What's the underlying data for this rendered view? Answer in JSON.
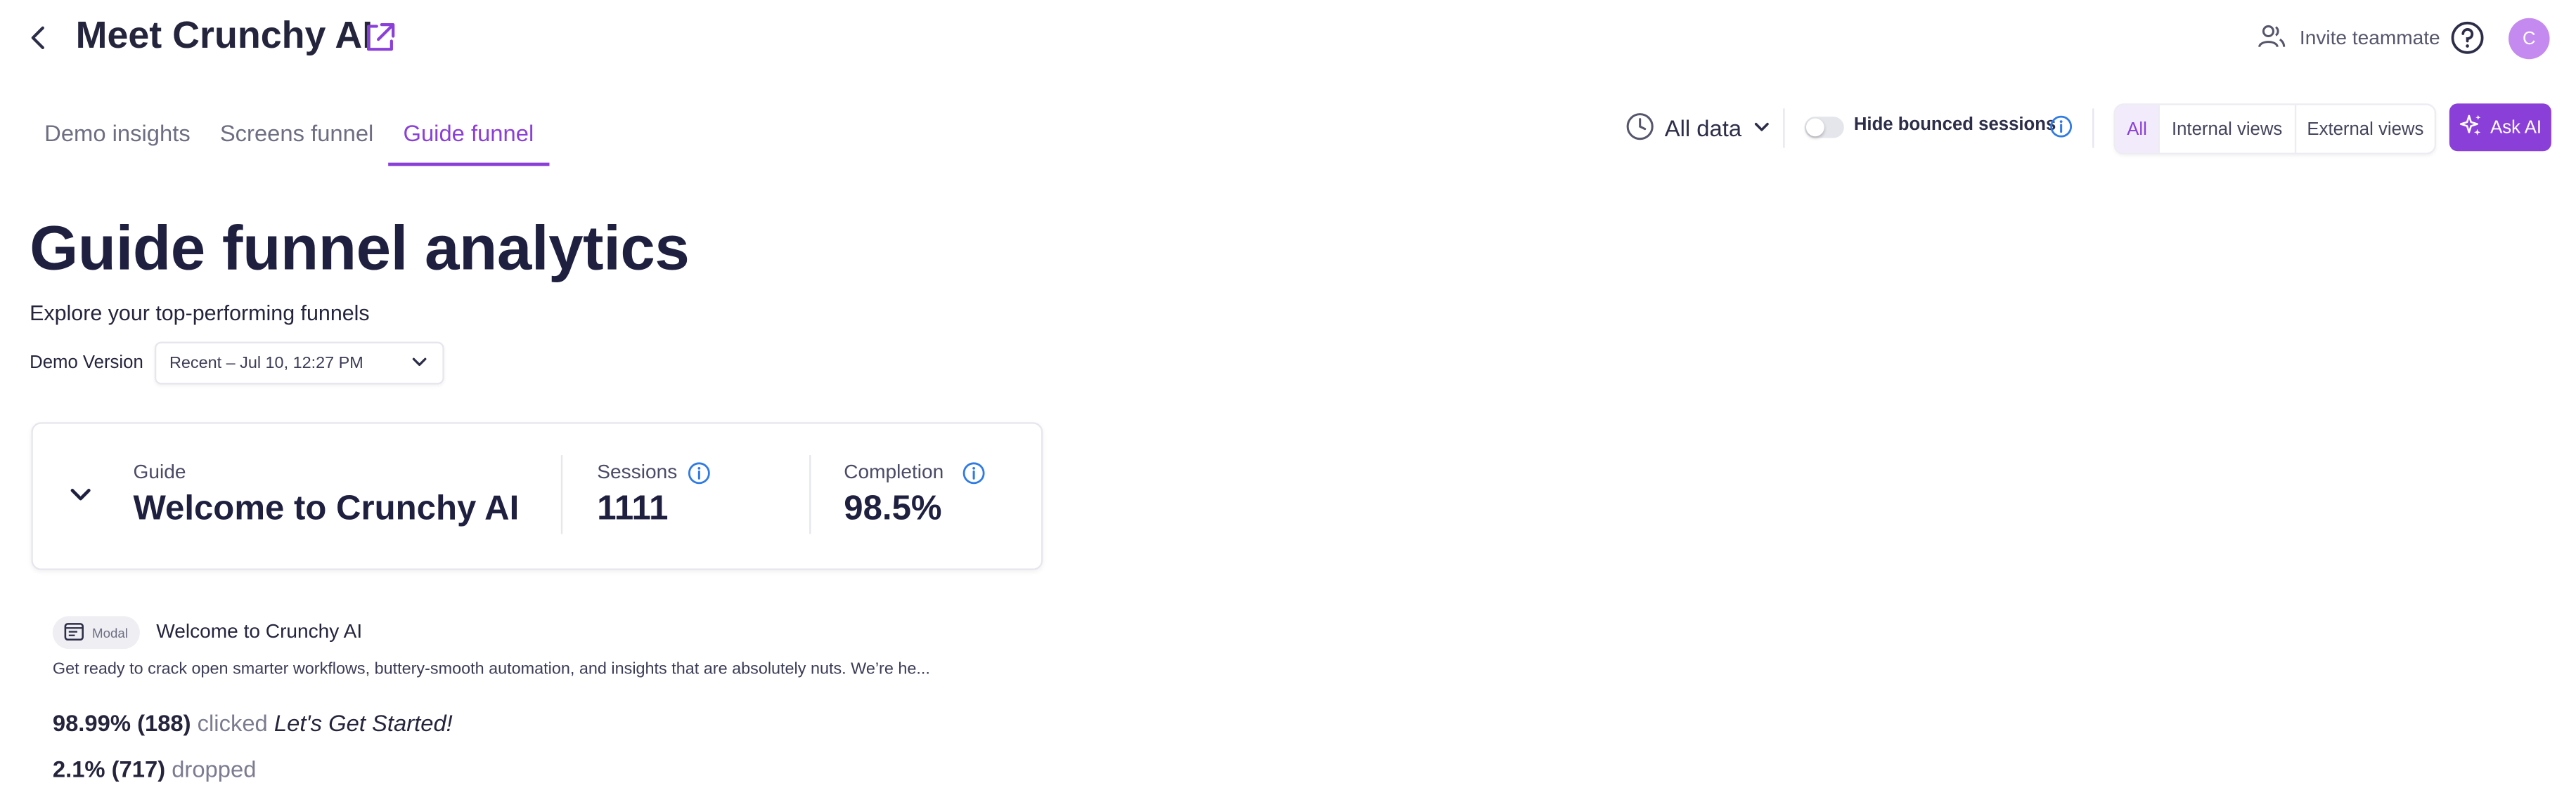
{
  "header": {
    "title": "Meet Crunchy AI",
    "invite_label": "Invite teammate",
    "avatar_initial": "C"
  },
  "tabs": [
    {
      "label": "Demo insights"
    },
    {
      "label": "Screens funnel"
    },
    {
      "label": "Guide funnel"
    }
  ],
  "active_tab": "Guide funnel",
  "toolbar": {
    "date_range": "All data",
    "hide_bounced_label": "Hide bounced sessions",
    "hide_bounced_enabled": false,
    "view_options": [
      "All",
      "Internal views",
      "External views"
    ],
    "selected_view": "All",
    "ask_ai_label": "Ask AI"
  },
  "main": {
    "heading": "Guide funnel analytics",
    "subtitle": "Explore your top-performing funnels",
    "demo_version_label": "Demo Version",
    "demo_version_value": "Recent – Jul 10, 12:27 PM"
  },
  "guide_card": {
    "guide_label": "Guide",
    "guide_name": "Welcome to Crunchy AI",
    "sessions_label": "Sessions",
    "sessions_value": "1111",
    "completion_label": "Completion",
    "completion_value": "98.5%"
  },
  "step": {
    "type_badge": "Modal",
    "title": "Welcome to Crunchy AI",
    "description": "Get ready to crack open smarter workflows, buttery-smooth automation, and insights that are absolutely nuts. We’re he...",
    "clicked_stat": "98.99% (188)",
    "clicked_word": "clicked",
    "clicked_target": "Let's Get Started!",
    "dropped_stat": "2.1% (717)",
    "dropped_word": "dropped"
  },
  "colors": {
    "accent": "#8b3fd9",
    "avatar": "#c58af0",
    "info_icon": "#2f7be5",
    "text_dark": "#1f2040"
  }
}
